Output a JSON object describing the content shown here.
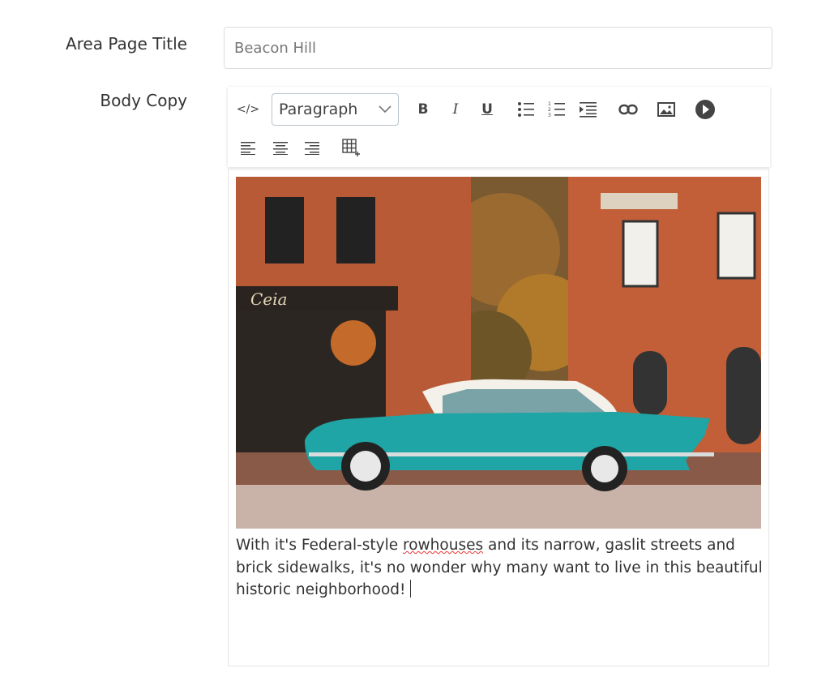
{
  "form": {
    "title_label": "Area Page Title",
    "title_value": "Beacon Hill",
    "body_label": "Body Copy"
  },
  "toolbar": {
    "format_select": "Paragraph",
    "icons": [
      "code-icon",
      "bold-icon",
      "italic-icon",
      "underline-icon",
      "bullet-list-icon",
      "numbered-list-icon",
      "indent-icon",
      "link-icon",
      "image-icon",
      "video-icon",
      "align-left-icon",
      "align-center-icon",
      "align-right-icon",
      "table-icon"
    ],
    "bold": "B",
    "italic": "I",
    "underline": "U",
    "code": "</>"
  },
  "editor": {
    "text_before": "With it's Federal-style ",
    "misspelled": "rowhouses",
    "text_after": " and its narrow, gaslit streets and brick sidewalks, it's no wonder why many want to live in this beautiful historic neighborhood!",
    "photo_sign": "Ceia"
  }
}
